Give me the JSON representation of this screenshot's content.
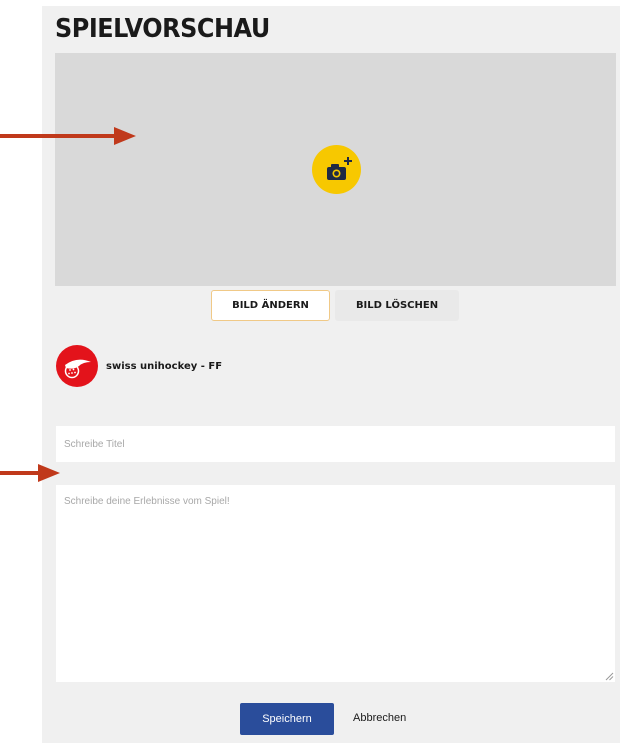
{
  "page": {
    "title": "SPIELVORSCHAU"
  },
  "image_area": {
    "upload_icon": "camera-plus-icon",
    "background": "#d9d9d9",
    "icon_color": "#f7c800"
  },
  "image_actions": {
    "change_label": "BILD ÄNDERN",
    "delete_label": "BILD LÖSCHEN"
  },
  "club": {
    "name": "swiss unihockey - FF",
    "avatar_icon": "swiss-unihockey-logo",
    "avatar_color": "#e3131b"
  },
  "form": {
    "title_placeholder": "Schreibe Titel",
    "title_value": "",
    "body_placeholder": "Schreibe deine Erlebnisse vom Spiel!",
    "body_value": ""
  },
  "actions": {
    "save_label": "Speichern",
    "cancel_label": "Abbrechen",
    "save_color": "#2a4d9b"
  },
  "annotations": {
    "arrow_color": "#c0391b"
  }
}
